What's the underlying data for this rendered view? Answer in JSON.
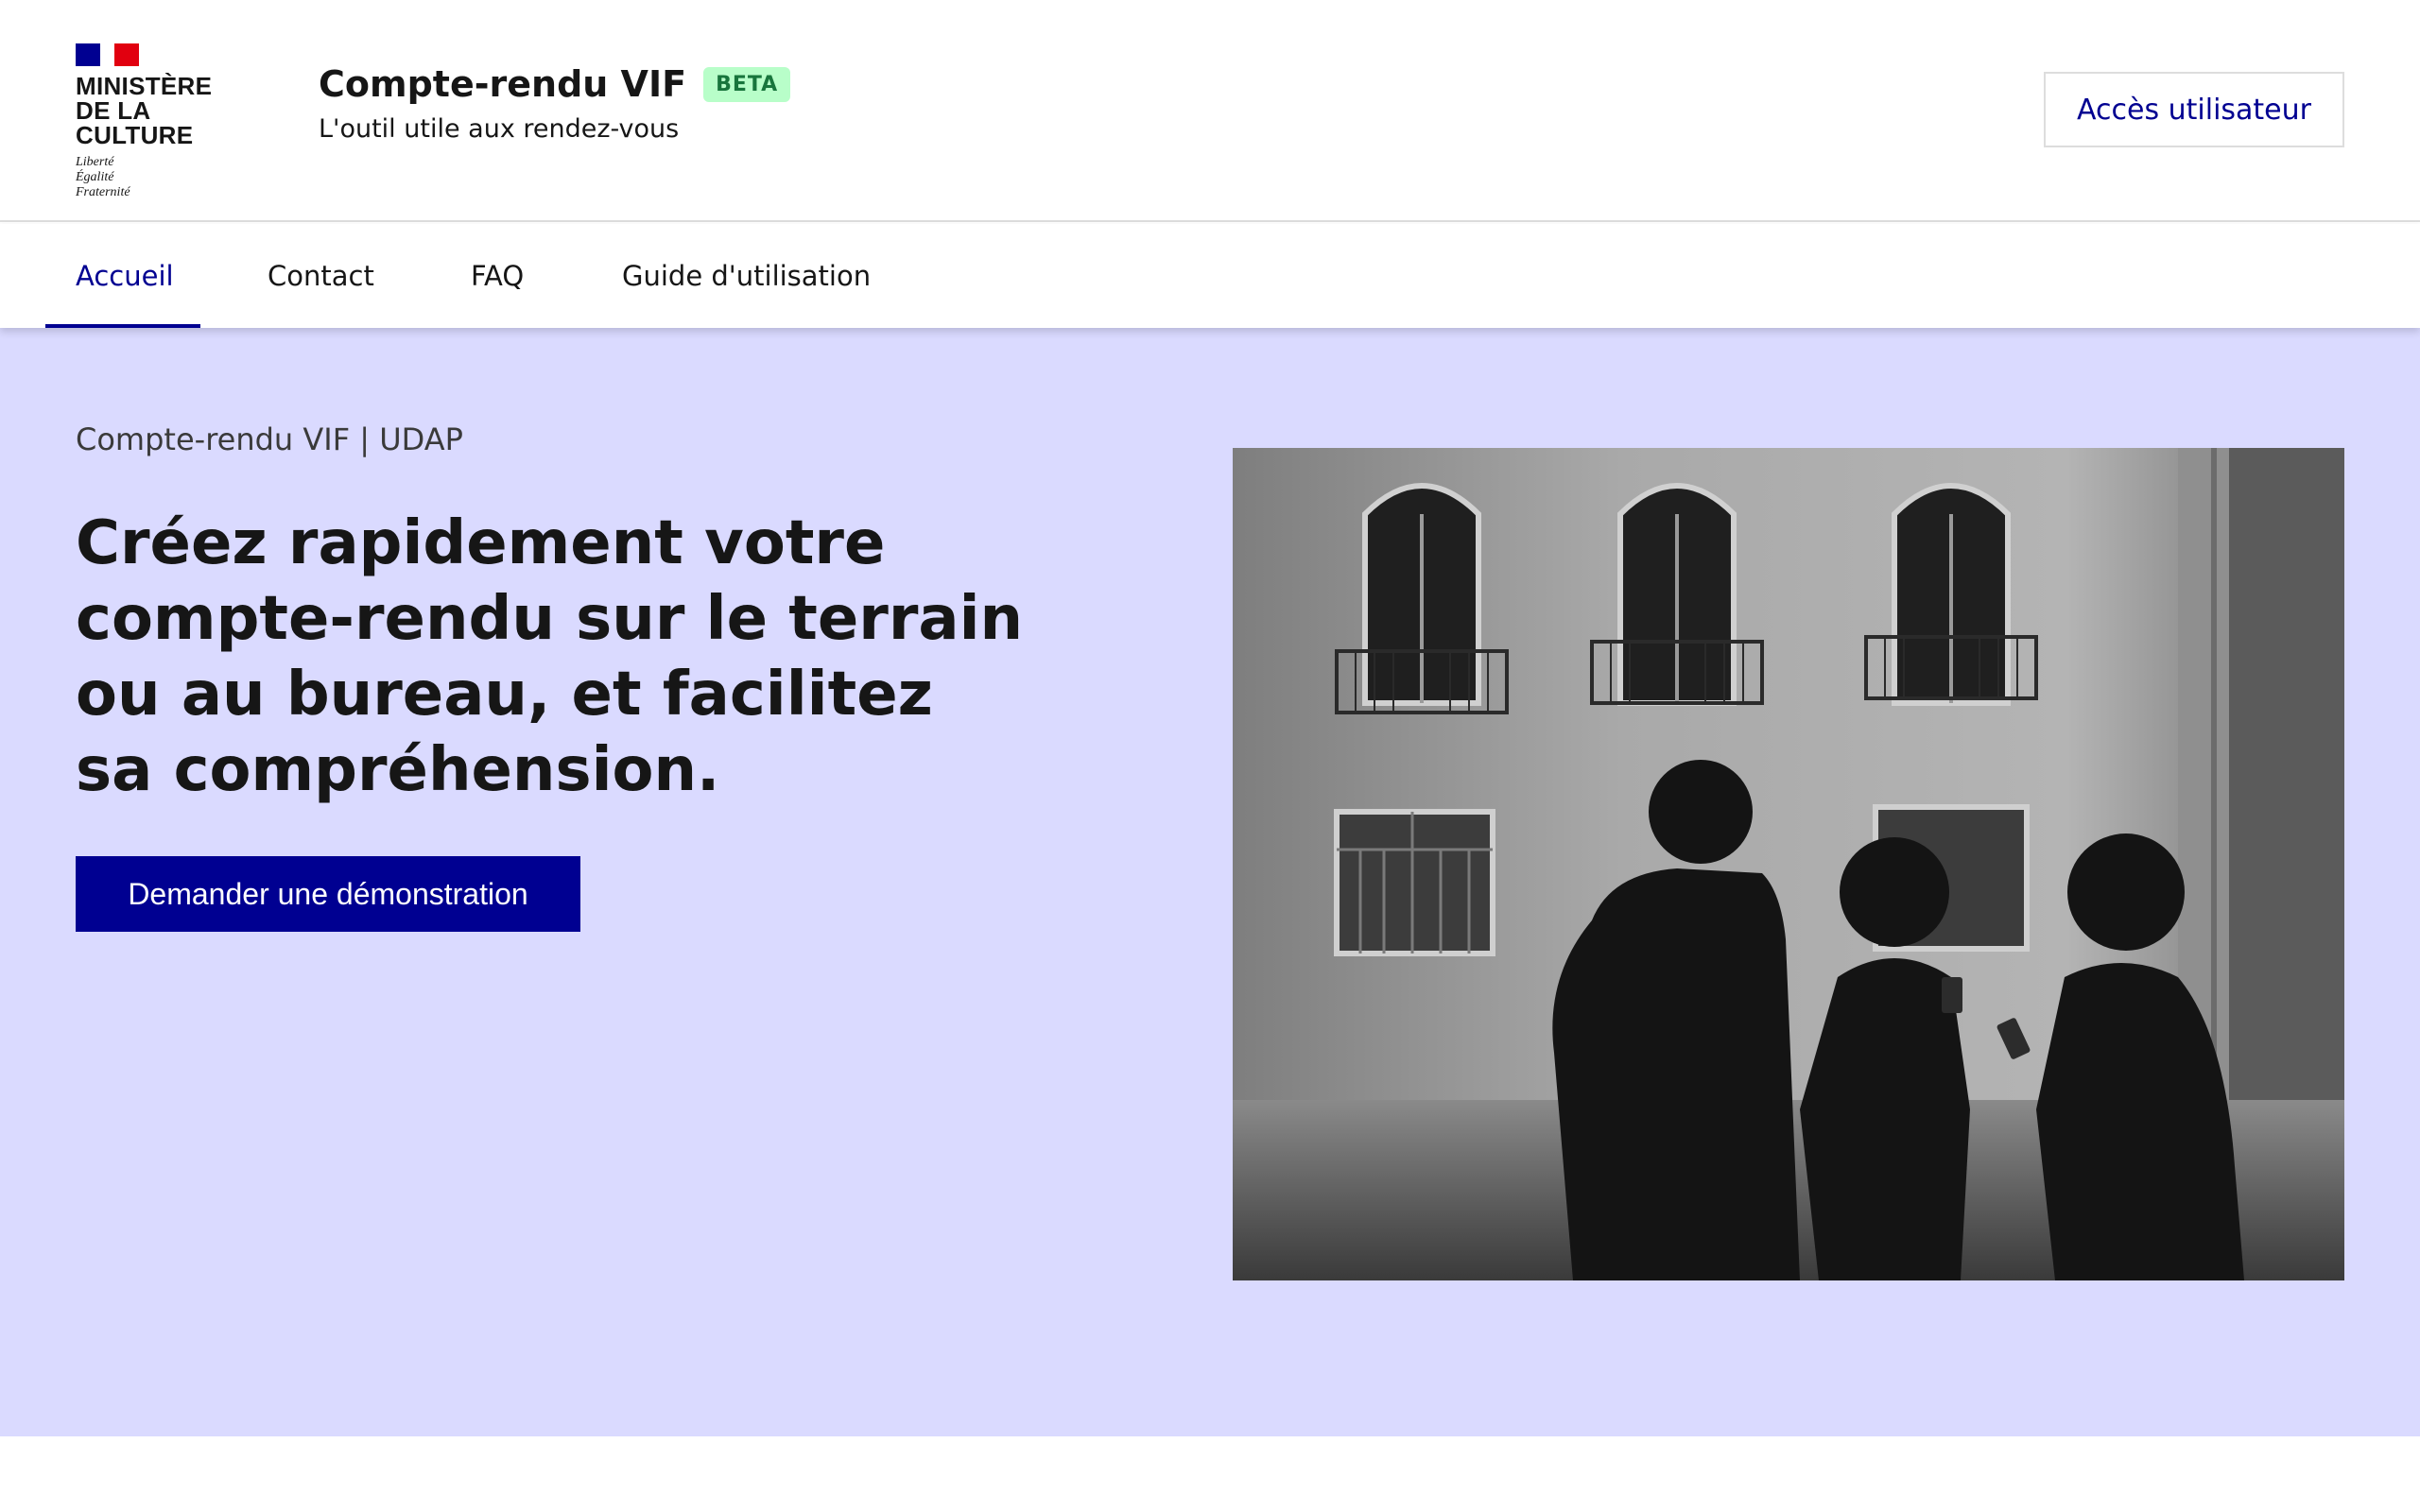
{
  "header": {
    "logo": {
      "ministry_line1": "MINISTÈRE",
      "ministry_line2": "DE LA CULTURE",
      "motto": [
        "Liberté",
        "Égalité",
        "Fraternité"
      ]
    },
    "service_title": "Compte-rendu VIF",
    "badge": "BETA",
    "tagline": "L'outil utile aux rendez-vous",
    "access_button": "Accès utilisateur"
  },
  "nav": {
    "items": [
      {
        "label": "Accueil",
        "active": true
      },
      {
        "label": "Contact",
        "active": false
      },
      {
        "label": "FAQ",
        "active": false
      },
      {
        "label": "Guide d'utilisation",
        "active": false
      }
    ]
  },
  "hero": {
    "eyebrow": "Compte-rendu VIF | UDAP",
    "title_lines": [
      "Créez rapidement votre",
      "compte-rendu sur le terrain",
      "ou au bureau, et facilitez",
      "sa compréhension."
    ],
    "cta": "Demander une démonstration",
    "image_subject": "three people looking at phones in front of a building facade, black and white"
  },
  "colors": {
    "primary": "#000091",
    "hero_background": "#dadaff",
    "badge_background": "#b8fec9",
    "badge_text": "#18753c",
    "flag_red": "#e1000f"
  }
}
